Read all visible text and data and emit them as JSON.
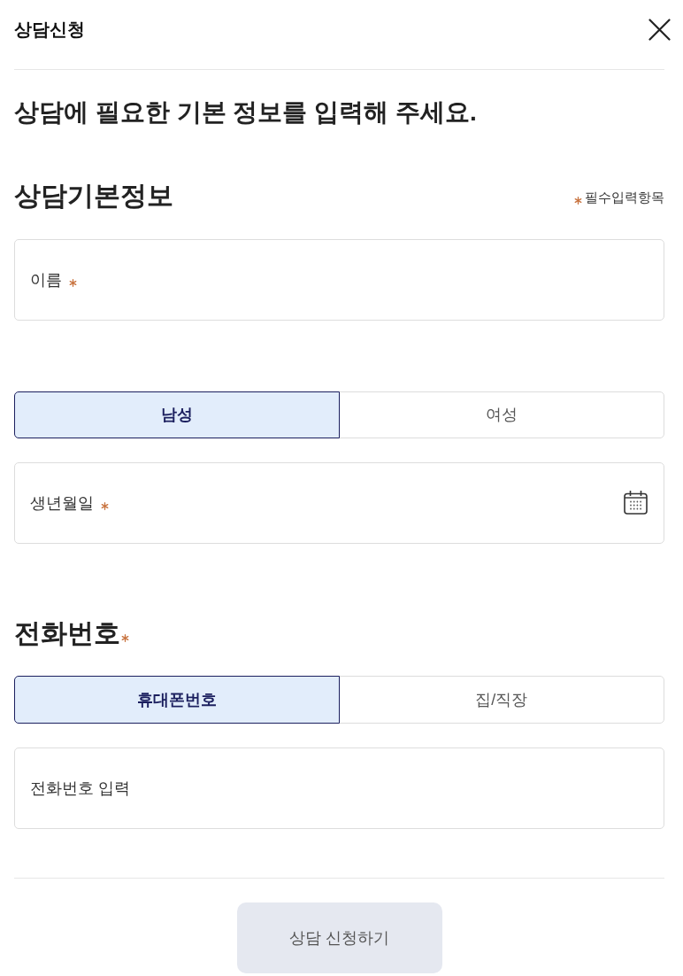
{
  "header": {
    "title": "상담신청"
  },
  "intro": "상담에 필요한 기본 정보를 입력해 주세요.",
  "basic_section": {
    "title": "상담기본정보",
    "required_legend": "필수입력항목",
    "items": [
      {
        "kind": "text_field",
        "label": "이름",
        "required": true
      },
      {
        "kind": "choice",
        "options": [
          {
            "label": "남성",
            "selected": true
          },
          {
            "label": "여성",
            "selected": false
          }
        ]
      },
      {
        "kind": "date_field",
        "label": "생년월일",
        "required": true
      }
    ]
  },
  "phone_section": {
    "title": "전화번호",
    "required": true,
    "options": [
      {
        "label": "휴대폰번호",
        "selected": true
      },
      {
        "label": "집/직장",
        "selected": false
      }
    ],
    "input": {
      "placeholder": "전화번호 입력"
    }
  },
  "submit_button": {
    "label": "상담 신청하기",
    "disabled": true
  }
}
